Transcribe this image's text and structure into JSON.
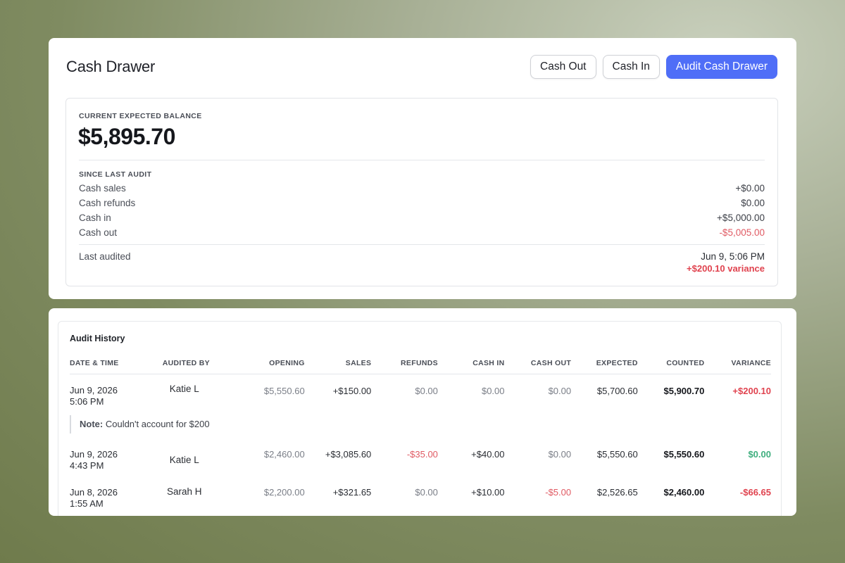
{
  "header": {
    "title": "Cash Drawer",
    "buttons": {
      "cash_out": "Cash Out",
      "cash_in": "Cash In",
      "audit": "Audit Cash Drawer"
    },
    "accent_color": "#4f6ef7"
  },
  "balance": {
    "label": "CURRENT EXPECTED BALANCE",
    "value": "$5,895.70",
    "since_label": "SINCE LAST AUDIT",
    "rows": [
      {
        "label": "Cash sales",
        "value": "+$0.00"
      },
      {
        "label": "Cash refunds",
        "value": "$0.00"
      },
      {
        "label": "Cash in",
        "value": "+$5,000.00"
      },
      {
        "label": "Cash out",
        "value": "-$5,005.00"
      }
    ],
    "last_audited_label": "Last audited",
    "last_audited_date": "Jun 9, 5:06 PM",
    "last_audited_variance": "+$200.10 variance"
  },
  "history": {
    "title": "Audit History",
    "columns": [
      "DATE & TIME",
      "AUDITED BY",
      "OPENING",
      "SALES",
      "REFUNDS",
      "CASH IN",
      "CASH OUT",
      "EXPECTED",
      "COUNTED",
      "VARIANCE"
    ],
    "rows": [
      {
        "date": "Jun 9, 2026",
        "time": "5:06 PM",
        "by": "Katie L",
        "opening": "$5,550.60",
        "sales": "+$150.00",
        "refunds": "$0.00",
        "cash_in": "$0.00",
        "cash_out": "$0.00",
        "expected": "$5,700.60",
        "counted": "$5,900.70",
        "variance": "+$200.10",
        "note_label": "Note:",
        "note_text": "Couldn't account for $200"
      },
      {
        "date": "Jun 9, 2026",
        "time": "4:43 PM",
        "by": "Katie L",
        "opening": "$2,460.00",
        "sales": "+$3,085.60",
        "refunds": "-$35.00",
        "cash_in": "+$40.00",
        "cash_out": "$0.00",
        "expected": "$5,550.60",
        "counted": "$5,550.60",
        "variance": "$0.00"
      },
      {
        "date": "Jun 8, 2026",
        "time": "1:55 AM",
        "by": "Sarah H",
        "opening": "$2,200.00",
        "sales": "+$321.65",
        "refunds": "$0.00",
        "cash_in": "+$10.00",
        "cash_out": "-$5.00",
        "expected": "$2,526.65",
        "counted": "$2,460.00",
        "variance": "-$66.65"
      }
    ],
    "colors": {
      "negative": "#e05a63",
      "positive": "#3fae7e"
    }
  }
}
